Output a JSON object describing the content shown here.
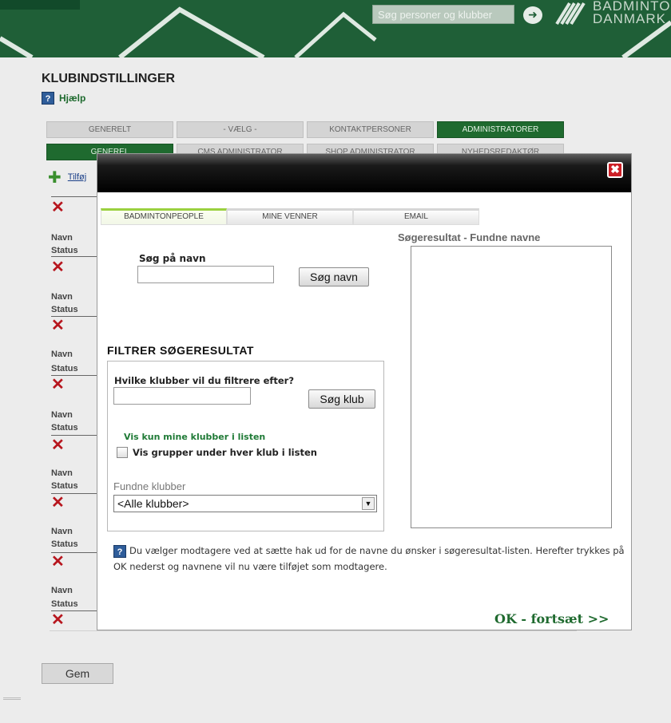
{
  "header": {
    "search_placeholder": "Søg personer og klubber",
    "brand_line1": "BADMINTO",
    "brand_line2": "DANMARK",
    "colors": {
      "banner": "#1f5f37",
      "accent": "#1f6a2f"
    }
  },
  "page": {
    "title": "KLUBINDSTILLINGER",
    "help": "Hjælp",
    "tabs_main": [
      "GENERELT",
      "- VÆLG -",
      "KONTAKTPERSONER",
      "ADMINISTRATORER"
    ],
    "tabs_main_active": "ADMINISTRATORER",
    "tabs_sub": [
      "GENEREL",
      "CMS ADMINISTRATOR",
      "SHOP ADMINISTRATOR",
      "NYHEDSREDAKTØR"
    ],
    "tabs_sub_active": "GENEREL",
    "add_label": "Tilføj",
    "list_labels": {
      "navn": "Navn",
      "status": "Status"
    },
    "save_button": "Gem"
  },
  "modal": {
    "tabs": [
      "BADMINTONPEOPLE",
      "MINE VENNER",
      "EMAIL"
    ],
    "active_tab": "BADMINTONPEOPLE",
    "search_name_label": "Søg på navn",
    "search_name_value": "",
    "search_name_button": "Søg navn",
    "results_title": "Søgeresultat - Fundne navne",
    "filter_title": "FILTRER SØGERESULTAT",
    "club_question": "Hvilke klubber vil du filtrere efter?",
    "club_input_value": "",
    "club_search_button": "Søg klub",
    "show_my_clubs_link": "Vis kun mine klubber i listen",
    "show_groups_label": "Vis grupper under hver klub i listen",
    "show_groups_checked": false,
    "found_clubs_label": "Fundne klubber",
    "found_clubs_selected": "<Alle klubber>",
    "info_text": "Du vælger modtagere ved at sætte hak ud for de navne du ønsker i søgeresultat-listen. Herefter trykkes på OK nederst og navnene vil nu være tilføjet som modtagere.",
    "ok_button": "OK - fortsæt >>"
  }
}
